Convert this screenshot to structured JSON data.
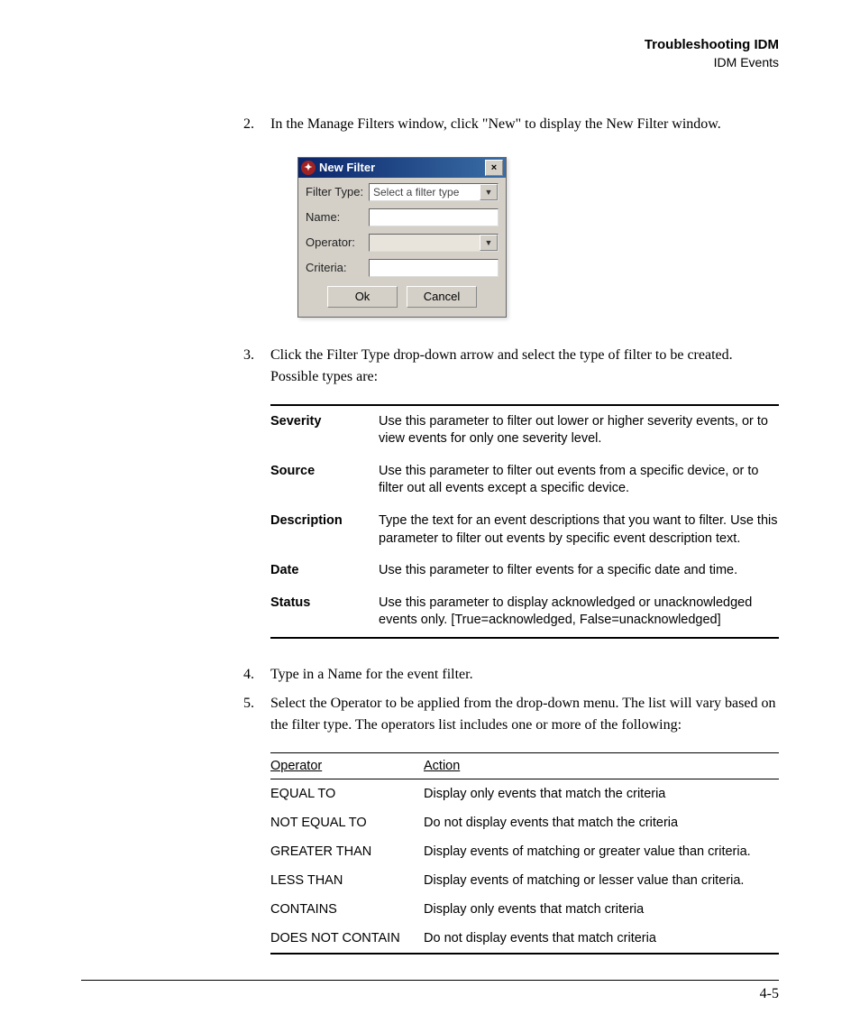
{
  "header": {
    "title": "Troubleshooting IDM",
    "subtitle": "IDM Events"
  },
  "steps": {
    "s2": {
      "num": "2.",
      "text": "In the Manage Filters window, click \"New\" to display the New Filter window."
    },
    "s3": {
      "num": "3.",
      "text": "Click the Filter Type drop-down arrow and select the type of filter to be created. Possible types are:"
    },
    "s4": {
      "num": "4.",
      "text": "Type in a Name for the event filter."
    },
    "s5": {
      "num": "5.",
      "text": "Select the Operator to be applied from the drop-down menu. The list will vary based on the filter type. The operators list includes one or more of the following:"
    }
  },
  "dialog": {
    "title": "New Filter",
    "close_glyph": "×",
    "labels": {
      "filter_type": "Filter Type:",
      "name": "Name:",
      "operator": "Operator:",
      "criteria": "Criteria:"
    },
    "filter_type_placeholder": "Select a filter type",
    "arrow_glyph": "▼",
    "ok": "Ok",
    "cancel": "Cancel"
  },
  "params": [
    {
      "name": "Severity",
      "desc": "Use this parameter to filter out lower or higher severity events, or to view events for only one severity level."
    },
    {
      "name": "Source",
      "desc": "Use this parameter to filter out events from a specific device, or to filter out all events except a specific device."
    },
    {
      "name": "Description",
      "desc": "Type the text for an event descriptions that you want to filter. Use this parameter to filter out events by specific event description text."
    },
    {
      "name": "Date",
      "desc": "Use this parameter to filter events for a specific date and time."
    },
    {
      "name": "Status",
      "desc": "Use this parameter to display acknowledged or unacknowledged events only. [True=acknowledged, False=unacknowledged]"
    }
  ],
  "op_header": {
    "col1": "Operator",
    "col2": "Action"
  },
  "operators": [
    {
      "name": "EQUAL TO",
      "action": "Display only events that match the criteria"
    },
    {
      "name": "NOT EQUAL TO",
      "action": "Do not display events that match the criteria"
    },
    {
      "name": "GREATER THAN",
      "action": "Display events of matching or greater value than criteria."
    },
    {
      "name": "LESS THAN",
      "action": "Display events of matching or lesser value than criteria."
    },
    {
      "name": "CONTAINS",
      "action": "Display only events that match criteria"
    },
    {
      "name": "DOES NOT CONTAIN",
      "action": "Do not display events that match criteria"
    }
  ],
  "page_number": "4-5"
}
